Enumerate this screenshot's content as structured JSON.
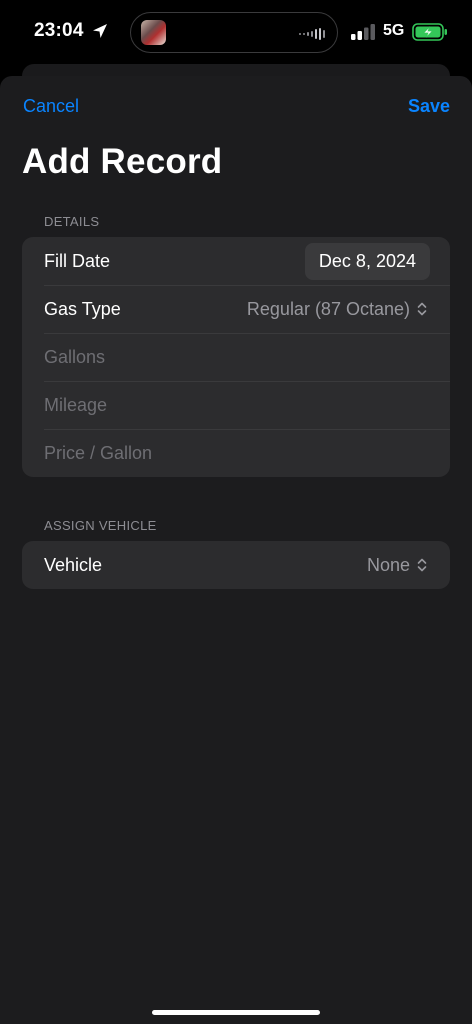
{
  "status_bar": {
    "time": "23:04",
    "network": "5G"
  },
  "nav": {
    "cancel_label": "Cancel",
    "save_label": "Save"
  },
  "page_title": "Add Record",
  "details_section": {
    "header": "DETAILS",
    "fill_date_label": "Fill Date",
    "fill_date_value": "Dec 8, 2024",
    "gas_type_label": "Gas Type",
    "gas_type_value": "Regular (87 Octane)",
    "gallons_placeholder": "Gallons",
    "mileage_placeholder": "Mileage",
    "price_placeholder": "Price / Gallon"
  },
  "vehicle_section": {
    "header": "ASSIGN VEHICLE",
    "vehicle_label": "Vehicle",
    "vehicle_value": "None"
  },
  "colors": {
    "accent": "#0a84ff",
    "sheet_bg": "#1c1c1e",
    "group_bg": "#2c2c2e",
    "battery_charging": "#34c759"
  },
  "icons": [
    "location-arrow-icon",
    "cellular-signal-icon",
    "battery-charging-icon",
    "chevron-updown-icon"
  ]
}
